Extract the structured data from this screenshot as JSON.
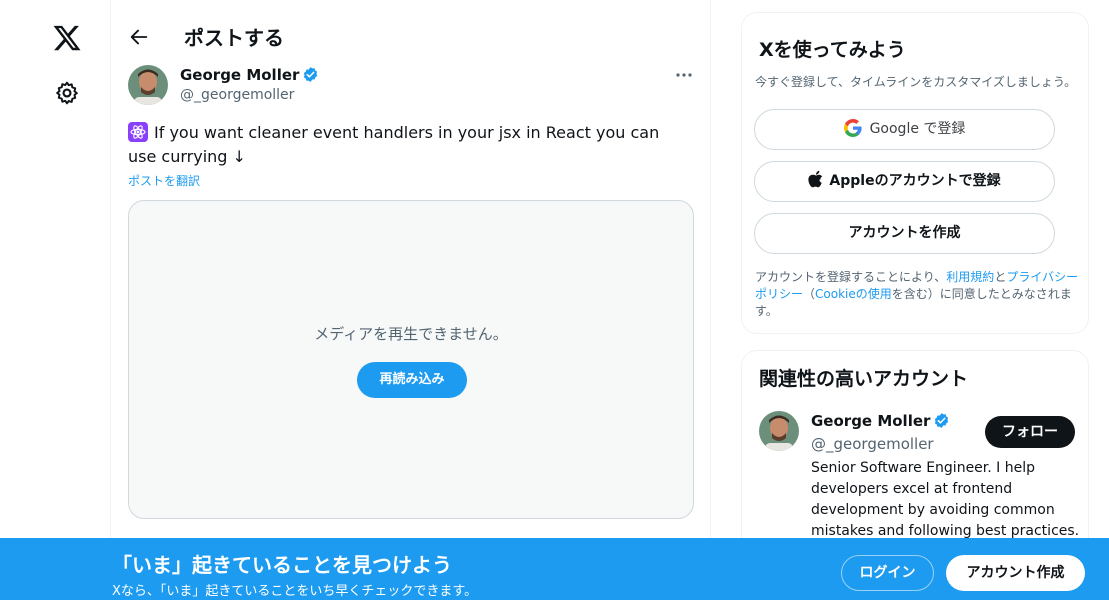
{
  "colors": {
    "accent": "#1d9bf0",
    "text": "#0f1419",
    "muted": "#536471",
    "border": "#cfd9de"
  },
  "nav": {
    "logo_icon": "x-logo-icon",
    "settings_icon": "gear-icon"
  },
  "header": {
    "back_icon": "arrow-left-icon",
    "title": "ポストする"
  },
  "post": {
    "author": {
      "name": "George Moller",
      "handle": "@_georgemoller",
      "verified_icon": "verified-badge-icon"
    },
    "more_icon": "more-icon",
    "text": "If you want cleaner event handlers in your jsx in React you can use currying ↓",
    "emoji_icon": "react-atom-icon",
    "translate_label": "ポストを翻訳",
    "media": {
      "message": "メディアを再生できません。",
      "reload_label": "再読み込み"
    }
  },
  "signup": {
    "title": "Xを使ってみよう",
    "subtitle": "今すぐ登録して、タイムラインをカスタマイズしましょう。",
    "google_label": "Google で登録",
    "apple_label": "Appleのアカウントで登録",
    "create_label": "アカウントを作成",
    "terms": {
      "prefix": "アカウントを登録することにより、",
      "tos": "利用規約",
      "and": "と",
      "privacy": "プライバシーポリシー",
      "paren_open": "（",
      "cookie": "Cookieの使用",
      "suffix": "を含む）に同意したとみなされます。"
    }
  },
  "related": {
    "title": "関連性の高いアカウント",
    "account": {
      "name": "George Moller",
      "handle": "@_georgemoller",
      "follow_label": "フォロー",
      "bio": "Senior Software Engineer. I help developers excel at frontend development by avoiding common mistakes and following best practices."
    }
  },
  "banner": {
    "title": "「いま」起きていることを見つけよう",
    "subtitle": "Xなら、「いま」起きていることをいち早くチェックできます。",
    "login_label": "ログイン",
    "signup_label": "アカウント作成"
  }
}
